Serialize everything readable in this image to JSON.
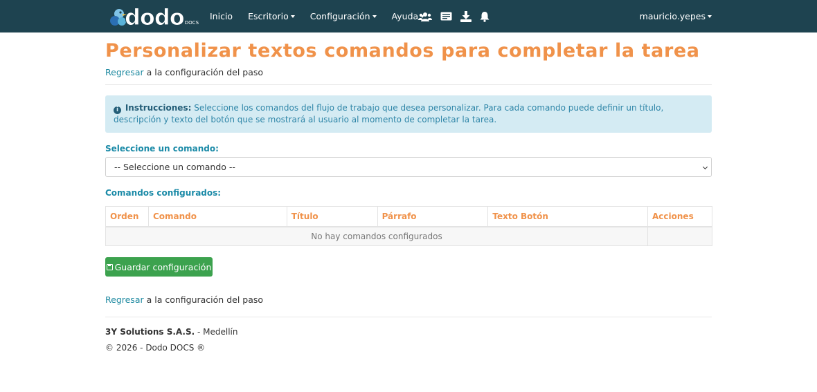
{
  "brand": {
    "name": "dodo",
    "suffix": "DOCS",
    "colors": {
      "navbar": "#1e4350",
      "accent": "#f0924a",
      "teal": "#1a8aa7",
      "success": "#3ca24e",
      "alert_bg": "#d4ebf3"
    }
  },
  "nav": {
    "items": [
      {
        "label": "Inicio",
        "dropdown": false
      },
      {
        "label": "Escritorio",
        "dropdown": true
      },
      {
        "label": "Configuración",
        "dropdown": true
      },
      {
        "label": "Ayuda",
        "dropdown": true
      }
    ],
    "icons": [
      "users-icon",
      "id-card-icon",
      "download-icon",
      "bell-icon"
    ],
    "user": "mauricio.yepes"
  },
  "page": {
    "title": "Personalizar textos comandos para completar la tarea",
    "back_link": "Regresar",
    "back_text": " a la configuración del paso"
  },
  "instructions": {
    "label": "Instrucciones:",
    "text": " Seleccione los comandos del flujo de trabajo que desea personalizar. Para cada comando puede definir un título, descripción y texto del botón que se mostrará al usuario al momento de completar la tarea."
  },
  "command_select": {
    "label": "Seleccione un comando:",
    "selected": "-- Seleccione un comando --"
  },
  "configured": {
    "label": "Comandos configurados:",
    "columns": [
      "Orden",
      "Comando",
      "Título",
      "Párrafo",
      "Texto Botón",
      "Acciones"
    ],
    "empty_message": "No hay comandos configurados"
  },
  "actions": {
    "save_label": "Guardar configuración"
  },
  "footer": {
    "company": "3Y Solutions S.A.S.",
    "city": " - Medellín",
    "copyright": "© 2026 - Dodo DOCS ®"
  }
}
